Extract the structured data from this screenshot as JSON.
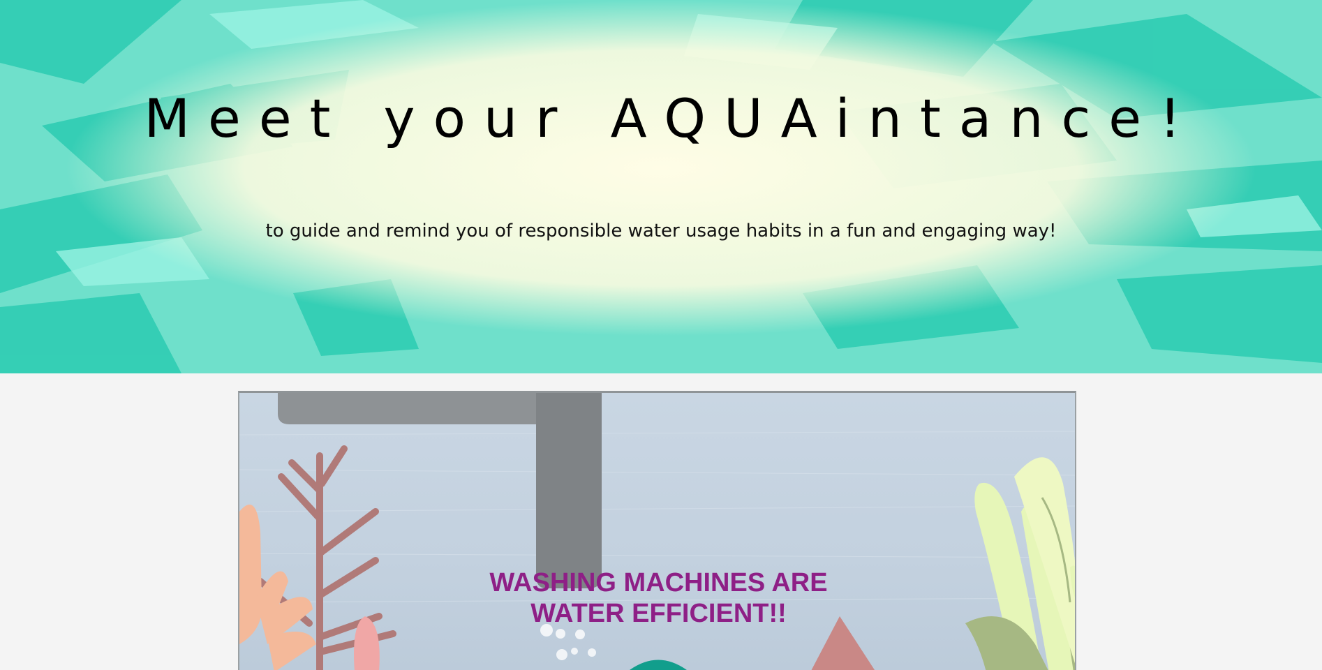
{
  "hero": {
    "title": "Meet your AQUAintance!",
    "subtitle": "to guide and remind you of responsible water usage habits in a fun and engaging way!"
  },
  "game": {
    "message_line1": "WASHING MACHINES ARE",
    "message_line2": "WATER EFFICIENT!!"
  },
  "colors": {
    "hero_teal": "#3fd9bf",
    "hero_cream": "#fffde6",
    "page_background": "#f4f4f4",
    "message_purple": "#8e1f86",
    "pipe_gray": "#7f8386"
  }
}
